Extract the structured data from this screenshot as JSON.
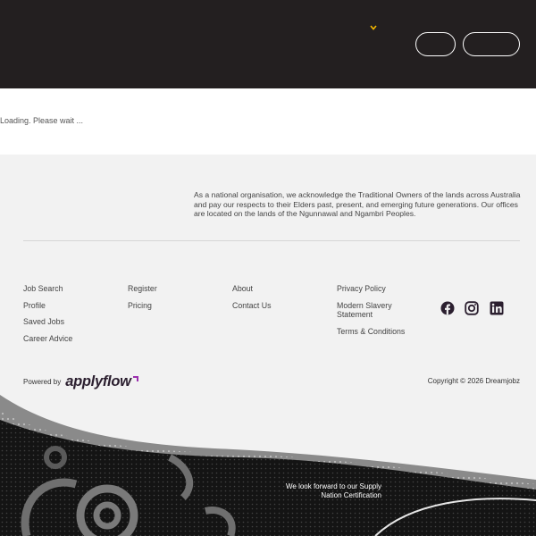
{
  "header": {
    "login_label": "",
    "post_label": ""
  },
  "loading": {
    "text": "Loading. Please wait ..."
  },
  "footer": {
    "acknowledgement": "As a national organisation, we acknowledge the Traditional Owners of the lands across Australia and pay our respects to their Elders past, present, and emerging future generations. Our offices are located on the lands of the Ngunnawal and Ngambri Peoples.",
    "columns": [
      [
        "Job Search",
        "Profile",
        "Saved Jobs",
        "Career Advice"
      ],
      [
        "Register",
        "Pricing"
      ],
      [
        "About",
        "Contact Us"
      ],
      [
        "Privacy Policy",
        "Modern Slavery Statement",
        "Terms & Conditions"
      ]
    ],
    "social": [
      "facebook-icon",
      "instagram-icon",
      "linkedin-icon"
    ],
    "powered_by": "Powered by",
    "applyflow": "applyflow",
    "copyright": "Copyright © 2026 Dreamjobz",
    "supply_nation": "We look forward to our Supply Nation Certification"
  },
  "colors": {
    "header_bg": "#231f20",
    "accent": "#f5b800",
    "footer_bg": "#f2f2f2",
    "logo_mark": "#9b2fae"
  }
}
